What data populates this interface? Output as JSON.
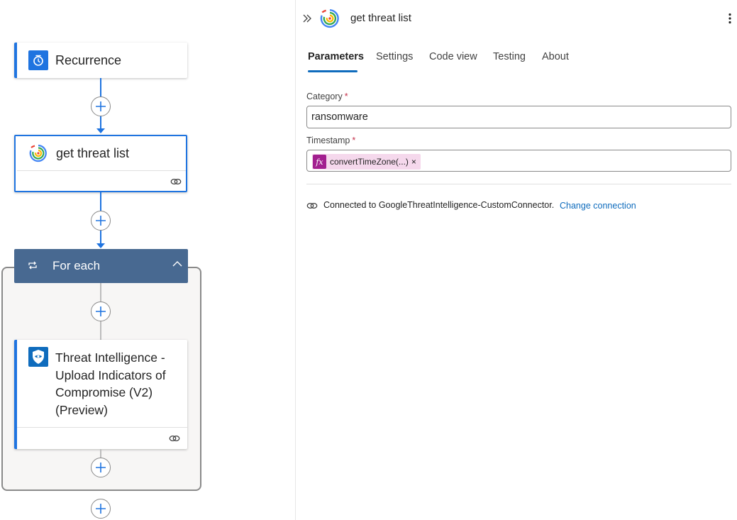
{
  "canvas": {
    "nodes": {
      "recurrence": {
        "title": "Recurrence"
      },
      "get_threat_list": {
        "title": "get threat list"
      },
      "for_each": {
        "title": "For each"
      },
      "threat_intel": {
        "title_lines": [
          "Threat Intelligence -",
          "Upload Indicators of",
          "Compromise (V2)",
          "(Preview)"
        ]
      }
    },
    "icons": {
      "recurrence": "alarm-clock-icon",
      "get_threat_list": "google-threat-intelligence-logo",
      "for_each": "loop-icon",
      "threat_intel": "shield-icon",
      "add": "plus-icon",
      "link": "link-icon"
    }
  },
  "panel": {
    "title": "get threat list",
    "tabs": [
      "Parameters",
      "Settings",
      "Code view",
      "Testing",
      "About"
    ],
    "active_tab": "Parameters",
    "fields": {
      "category": {
        "label": "Category",
        "required_mark": "*",
        "value": "ransomware"
      },
      "timestamp": {
        "label": "Timestamp",
        "required_mark": "*",
        "token_icon": "fx",
        "token_text": "convertTimeZone(...)",
        "token_remove": "×"
      }
    },
    "connection": {
      "text": "Connected to GoogleThreatIntelligence-CustomConnector.",
      "change_label": "Change connection"
    }
  },
  "colors": {
    "accent_blue": "#1f74e0",
    "foreach_header": "#486991",
    "token_bg": "#f5d8ec",
    "fx_badge": "#a21f8f",
    "link": "#0f6cbd",
    "required": "#c4314b"
  }
}
